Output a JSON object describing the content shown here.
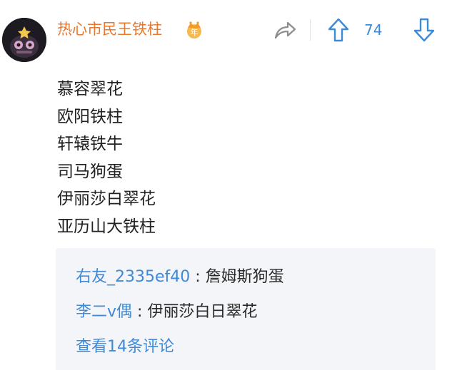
{
  "user": {
    "name": "热心市民王铁柱",
    "badge_text": "年",
    "badge_icon": "crown-icon",
    "avatar_icon": "avatar-image"
  },
  "actions": {
    "share_icon": "share-arrow-icon",
    "upvote_icon": "up-arrow-icon",
    "downvote_icon": "down-arrow-icon",
    "vote_count": "74"
  },
  "post": {
    "lines": [
      "慕容翠花",
      "欧阳铁柱",
      "轩辕铁牛",
      "司马狗蛋",
      "伊丽莎白翠花",
      "亚历山大铁柱"
    ]
  },
  "replies": [
    {
      "author": "右友_2335ef40",
      "separator": " : ",
      "text": "詹姆斯狗蛋"
    },
    {
      "author": "李二v偶",
      "separator": " : ",
      "text": "伊丽莎白日翠花"
    }
  ],
  "see_more": "查看14条评论",
  "colors": {
    "username": "#e8782d",
    "link_blue": "#3f8ad8",
    "reply_bg": "#f4f5f8",
    "icon_grey": "#8d8d8d"
  }
}
